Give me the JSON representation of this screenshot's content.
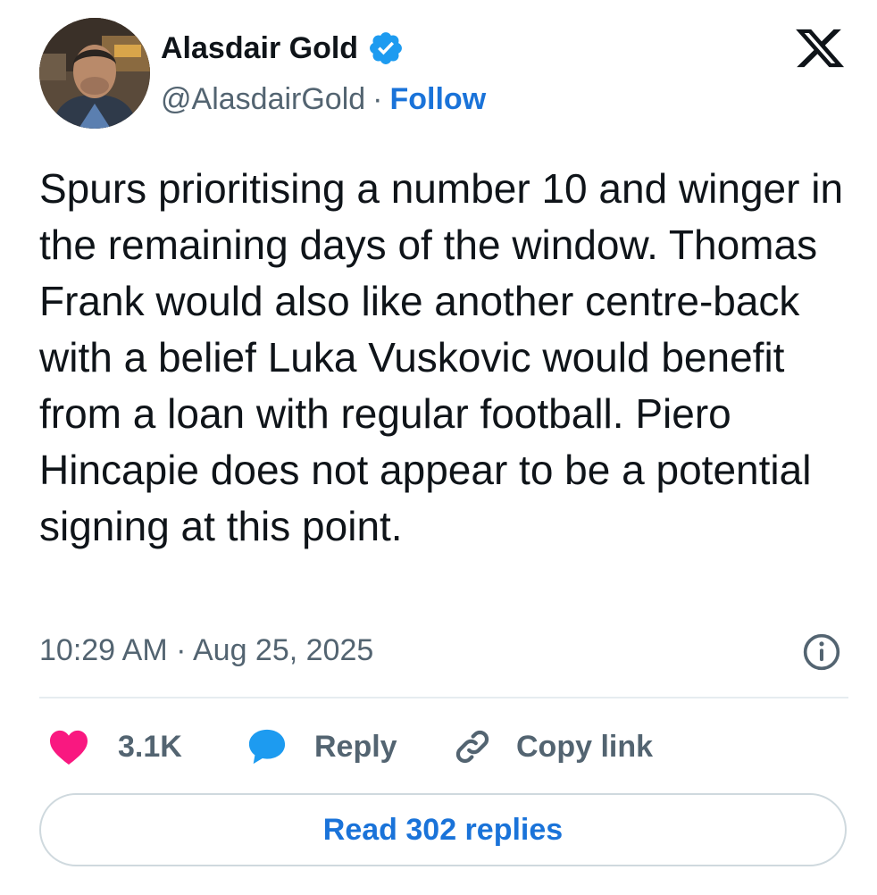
{
  "author": {
    "name": "Alasdair Gold",
    "handle": "@AlasdairGold",
    "separator": "·",
    "follow_label": "Follow"
  },
  "tweet": {
    "text": "Spurs prioritising a number 10 and winger in the remaining days of the window. Thomas Frank would also like another centre-back with a belief Luka Vuskovic would benefit from a loan with regular football. Piero Hincapie does not appear to be a potential signing at this point.",
    "timestamp": "10:29 AM · Aug 25, 2025"
  },
  "actions": {
    "likes_count": "3.1K",
    "reply_label": "Reply",
    "copy_link_label": "Copy link"
  },
  "read_replies_label": "Read 302 replies",
  "icons": {
    "verified": "verified-badge-icon",
    "logo": "x-logo-icon",
    "info": "info-icon",
    "like": "heart-icon",
    "reply": "speech-bubble-icon",
    "copy": "link-icon"
  },
  "colors": {
    "accent_blue": "#1a73d9",
    "verified_blue": "#1d9bf0",
    "heart_pink": "#f91880",
    "text_primary": "#0f1419",
    "text_secondary": "#536471",
    "divider": "#e6ecf0"
  }
}
